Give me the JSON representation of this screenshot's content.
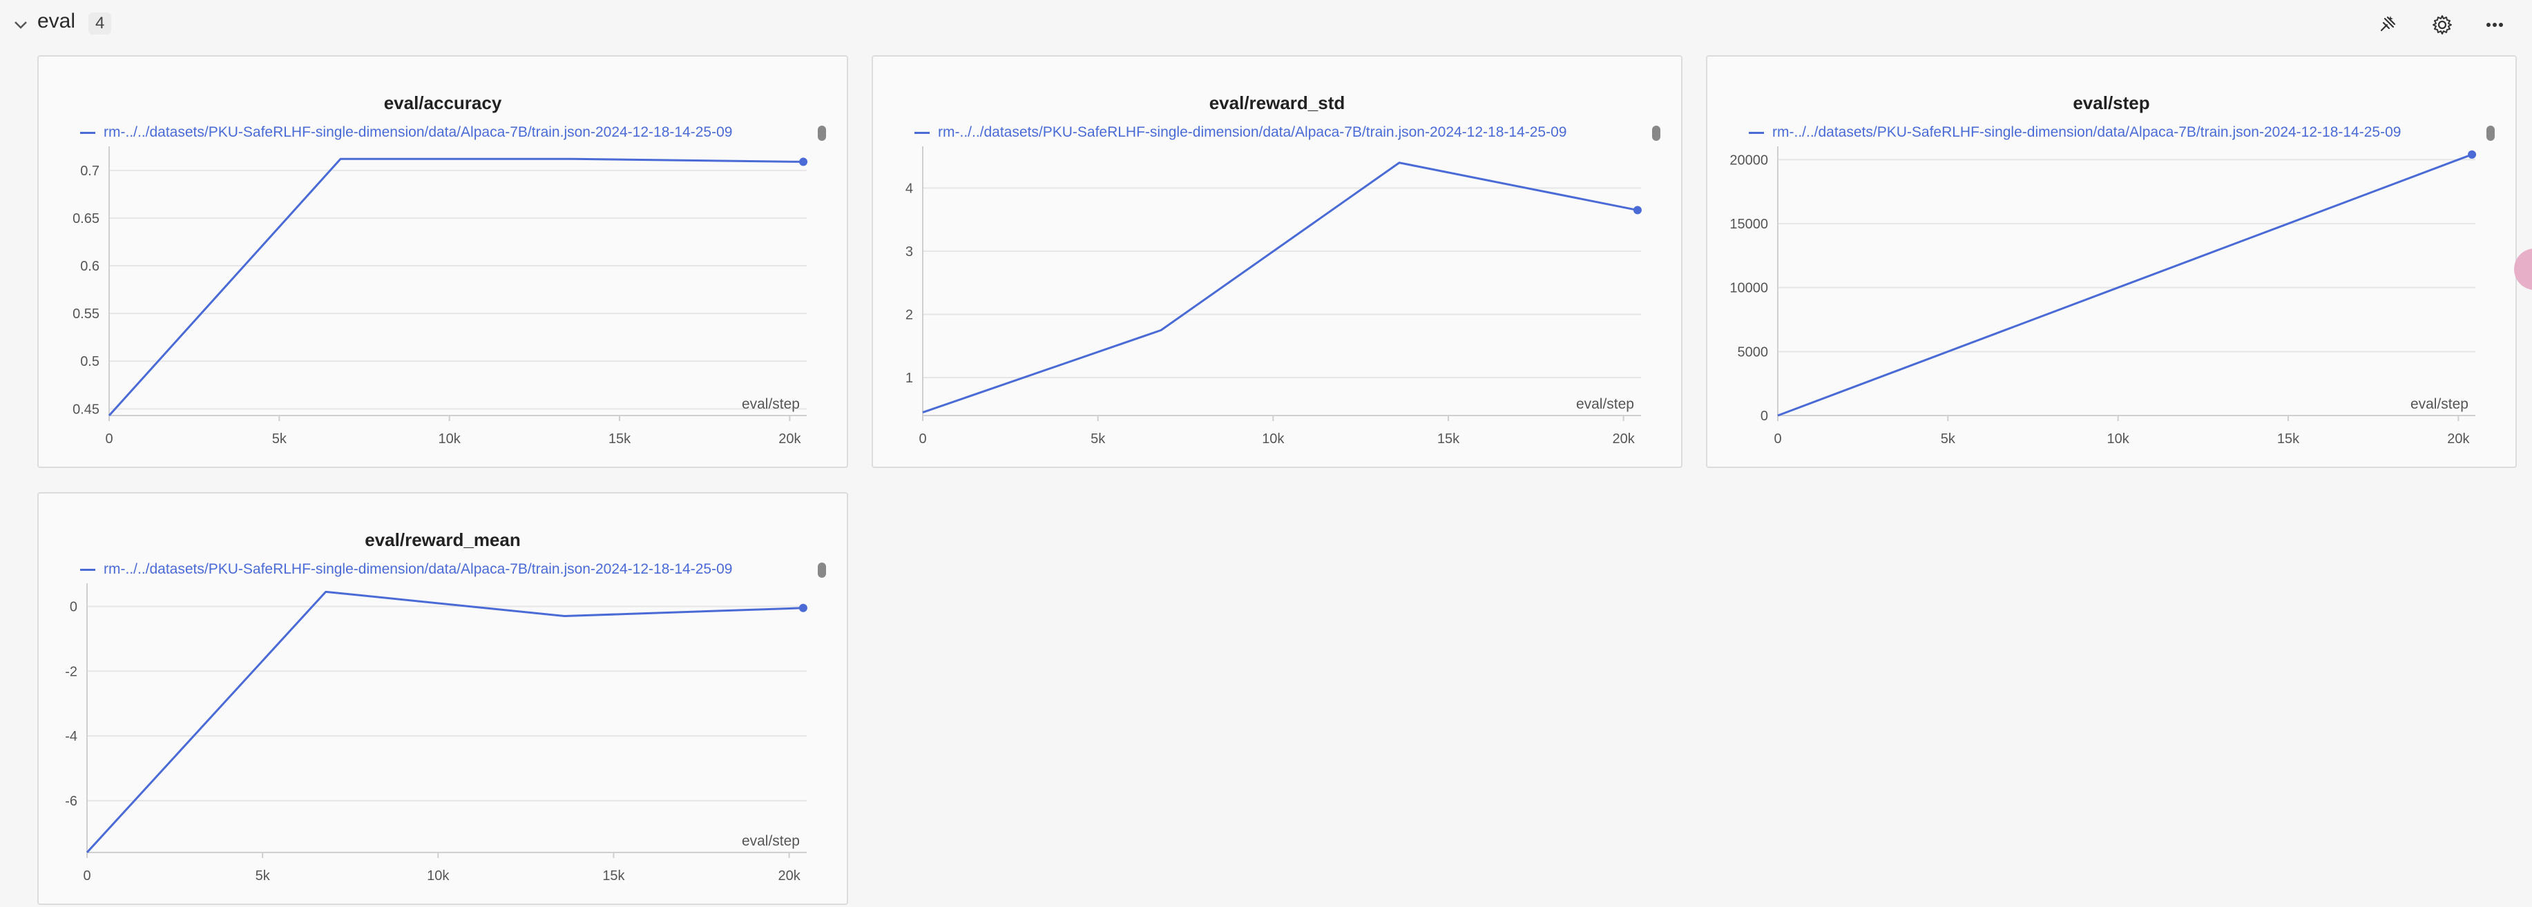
{
  "section": {
    "title": "eval",
    "count": "4",
    "icons": [
      "chevron-down-icon",
      "sparkle-pin-icon",
      "gear-icon",
      "more-dots-icon"
    ]
  },
  "accent_color": "#4a6bd6",
  "panels": [
    {
      "title": "eval/accuracy",
      "legend": "rm-../../datasets/PKU-SafeRLHF-single-dimension/data/Alpaca-7B/train.json-2024-12-18-14-25-09",
      "xaxis_title": "eval/step"
    },
    {
      "title": "eval/reward_std",
      "legend": "rm-../../datasets/PKU-SafeRLHF-single-dimension/data/Alpaca-7B/train.json-2024-12-18-14-25-09",
      "xaxis_title": "eval/step"
    },
    {
      "title": "eval/step",
      "legend": "rm-../../datasets/PKU-SafeRLHF-single-dimension/data/Alpaca-7B/train.json-2024-12-18-14-25-09",
      "xaxis_title": "eval/step"
    },
    {
      "title": "eval/reward_mean",
      "legend": "rm-../../datasets/PKU-SafeRLHF-single-dimension/data/Alpaca-7B/train.json-2024-12-18-14-25-09",
      "xaxis_title": "eval/step"
    }
  ],
  "chart_data": [
    {
      "type": "line",
      "title": "eval/accuracy",
      "xlabel": "eval/step",
      "ylabel": "",
      "x_ticks": [
        0,
        5000,
        10000,
        15000,
        20000
      ],
      "x_tick_labels": [
        "0",
        "5k",
        "10k",
        "15k",
        "20k"
      ],
      "y_ticks": [
        0.45,
        0.5,
        0.55,
        0.6,
        0.65,
        0.7
      ],
      "y_tick_labels": [
        "0.45",
        "0.5",
        "0.55",
        "0.6",
        "0.65",
        "0.7"
      ],
      "xlim": [
        0,
        20500
      ],
      "ylim": [
        0.443,
        0.718
      ],
      "series": [
        {
          "x": [
            0,
            6800,
            13600,
            20400
          ],
          "y": [
            0.443,
            0.712,
            0.712,
            0.709
          ]
        }
      ]
    },
    {
      "type": "line",
      "title": "eval/reward_std",
      "xlabel": "eval/step",
      "ylabel": "",
      "x_ticks": [
        0,
        5000,
        10000,
        15000,
        20000
      ],
      "x_tick_labels": [
        "0",
        "5k",
        "10k",
        "15k",
        "20k"
      ],
      "y_ticks": [
        1,
        2,
        3,
        4
      ],
      "y_tick_labels": [
        "1",
        "2",
        "3",
        "4"
      ],
      "xlim": [
        0,
        20500
      ],
      "ylim": [
        0.4,
        4.55
      ],
      "series": [
        {
          "x": [
            0,
            6800,
            13600,
            20400
          ],
          "y": [
            0.45,
            1.75,
            4.4,
            3.65
          ]
        }
      ]
    },
    {
      "type": "line",
      "title": "eval/step",
      "xlabel": "eval/step",
      "ylabel": "",
      "x_ticks": [
        0,
        5000,
        10000,
        15000,
        20000
      ],
      "x_tick_labels": [
        "0",
        "5k",
        "10k",
        "15k",
        "20k"
      ],
      "y_ticks": [
        0,
        5000,
        10000,
        15000,
        20000
      ],
      "y_tick_labels": [
        "0",
        "5000",
        "10000",
        "15000",
        "20000"
      ],
      "xlim": [
        0,
        20500
      ],
      "ylim": [
        0,
        20500
      ],
      "series": [
        {
          "x": [
            0,
            6800,
            13600,
            20400
          ],
          "y": [
            0,
            6800,
            13600,
            20400
          ]
        }
      ]
    },
    {
      "type": "line",
      "title": "eval/reward_mean",
      "xlabel": "eval/step",
      "ylabel": "",
      "x_ticks": [
        0,
        5000,
        10000,
        15000,
        20000
      ],
      "x_tick_labels": [
        "0",
        "5k",
        "10k",
        "15k",
        "20k"
      ],
      "y_ticks": [
        -6,
        -4,
        -2,
        0
      ],
      "y_tick_labels": [
        "-6",
        "-4",
        "-2",
        "0"
      ],
      "xlim": [
        0,
        20500
      ],
      "ylim": [
        -7.6,
        0.5
      ],
      "series": [
        {
          "x": [
            0,
            6800,
            13600,
            20400
          ],
          "y": [
            -7.6,
            0.45,
            -0.3,
            -0.05
          ]
        }
      ]
    }
  ]
}
